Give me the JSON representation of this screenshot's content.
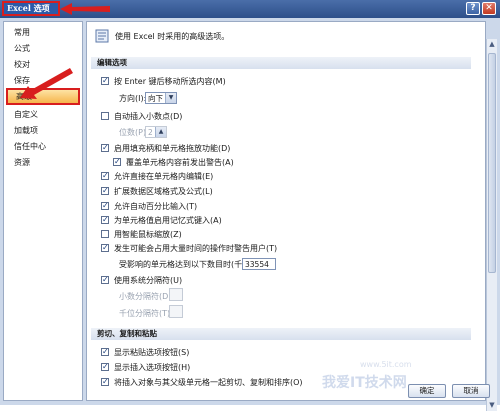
{
  "window": {
    "title": "Excel 选项",
    "help_label": "?",
    "close_label": "✕"
  },
  "sidebar": {
    "items": [
      {
        "label": "常用"
      },
      {
        "label": "公式"
      },
      {
        "label": "校对"
      },
      {
        "label": "保存"
      },
      {
        "label": "高级",
        "selected": true
      },
      {
        "label": "自定义"
      },
      {
        "label": "加载项"
      },
      {
        "label": "信任中心"
      },
      {
        "label": "资源"
      }
    ]
  },
  "content": {
    "header": "使用 Excel 时采用的高级选项。",
    "sections": {
      "editing": "编辑选项",
      "clipboard": "剪切、复制和粘贴"
    },
    "options": {
      "enter_move": "按 Enter 键后移动所选内容(M)",
      "direction_label": "方向(I):",
      "direction_value": "向下",
      "auto_decimal": "自动插入小数点(D)",
      "decimal_places_label": "位数(P):",
      "decimal_places_value": "2",
      "fill_handle": "启用填充柄和单元格拖放功能(D)",
      "alert_overwrite": "覆盖单元格内容前发出警告(A)",
      "direct_edit": "允许直接在单元格内编辑(E)",
      "extend_formats": "扩展数据区域格式及公式(L)",
      "auto_percent": "允许自动百分比输入(T)",
      "autocomplete": "为单元格值启用记忆式键入(A)",
      "intellimouse": "用智能鼠标缩放(Z)",
      "alert_slow": "发生可能会占用大量时间的操作时警告用户(T)",
      "cells_affected_label": "受影响的单元格达到以下数目时(千)(U):",
      "cells_affected_value": "33554",
      "system_separators": "使用系统分隔符(U)",
      "decimal_sep": "小数分隔符(D):",
      "thousands_sep": "千位分隔符(T):",
      "paste_options": "显示粘贴选项按钮(S)",
      "insert_options": "显示插入选项按钮(H)",
      "cut_copy_sort": "将插入对象与其父级单元格一起剪切、复制和排序(O)"
    }
  },
  "buttons": {
    "ok": "确定",
    "cancel": "取消"
  },
  "watermark": {
    "text": "我爱IT技术网",
    "url": "www.5it.com"
  },
  "colors": {
    "title_bar": "#2d4f8a",
    "highlight_border": "#d81e1e",
    "selected_item": "#f6b54c"
  }
}
